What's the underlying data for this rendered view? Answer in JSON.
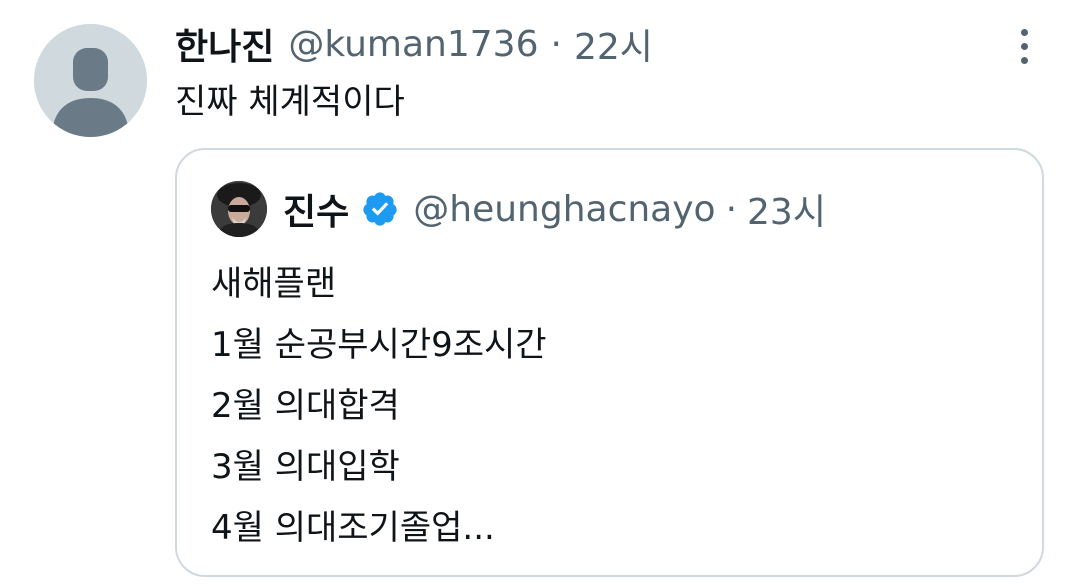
{
  "tweet": {
    "author": {
      "display_name": "한나진",
      "handle": "@kuman1736",
      "avatar_icon": "default-profile-icon"
    },
    "separator": "·",
    "time": "22시",
    "more_icon": "more-options-icon",
    "text": "진짜 체계적이다"
  },
  "quoted_tweet": {
    "author": {
      "display_name": "진수",
      "handle": "@heunghacnayo",
      "verified_icon": "verified-badge-icon",
      "verified_color": "#1d9bf0",
      "avatar_icon": "profile-photo-icon"
    },
    "separator": "·",
    "time": "23시",
    "lines": [
      "새해플랜",
      "1월 순공부시간9조시간",
      "2월 의대합격",
      "3월 의대입학",
      "4월 의대조기졸업..."
    ]
  },
  "colors": {
    "text_primary": "#0f1419",
    "text_secondary": "#536471",
    "border": "#cfd9de",
    "avatar_placeholder": "#cfd9de"
  }
}
